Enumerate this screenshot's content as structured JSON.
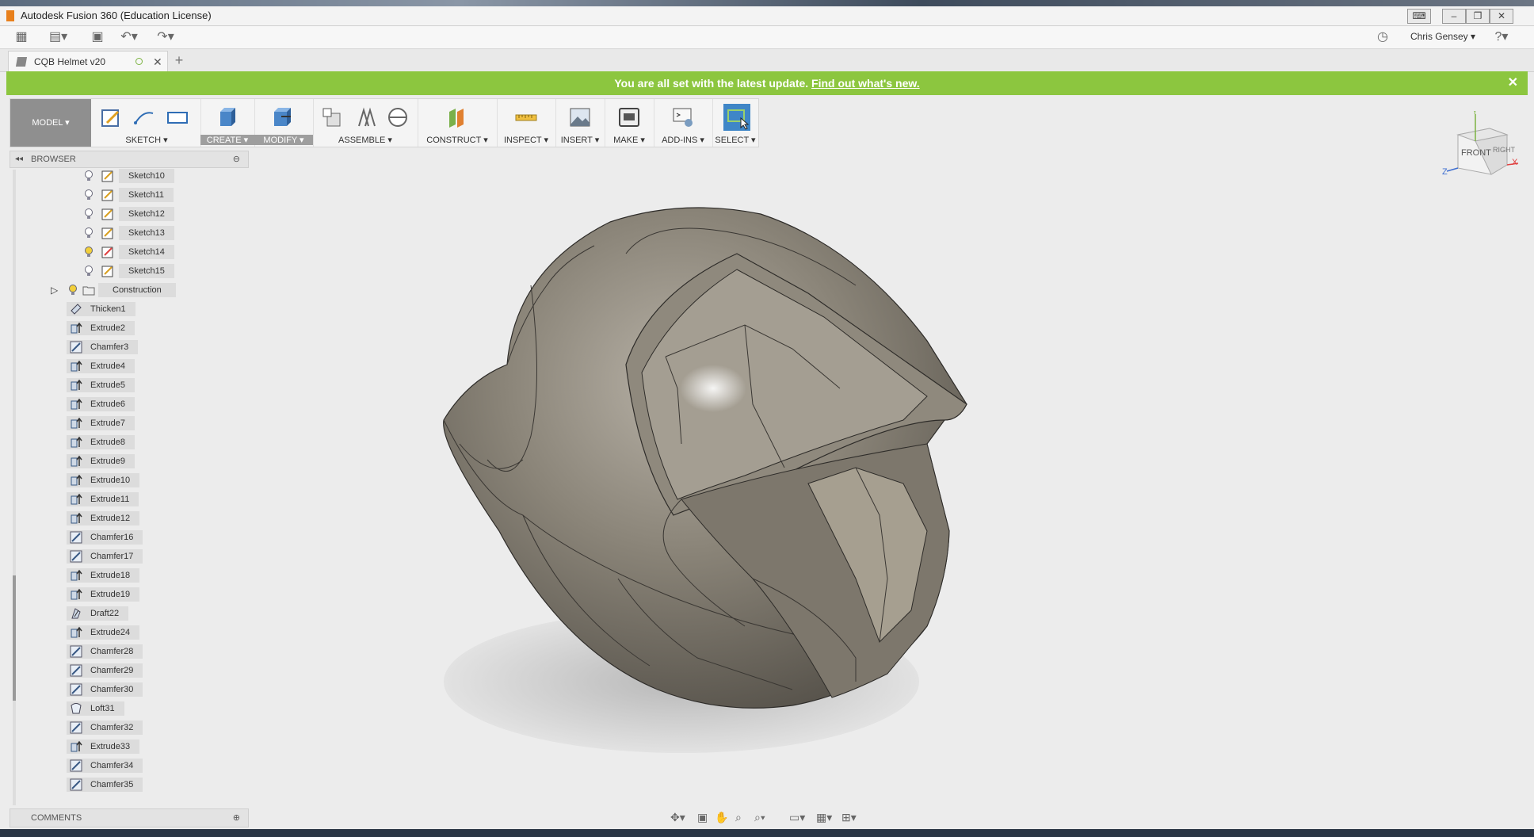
{
  "window": {
    "title": "Autodesk Fusion 360 (Education License)"
  },
  "toolbar": {
    "user": "Chris Gensey"
  },
  "tabs": {
    "document": "CQB Helmet v20",
    "new_tab": "+"
  },
  "notification": {
    "text": "You are all set with the latest update.",
    "link": "Find out what's new."
  },
  "ribbon": {
    "workspace": "MODEL",
    "groups": {
      "sketch": "SKETCH",
      "create": "CREATE",
      "modify": "MODIFY",
      "assemble": "ASSEMBLE",
      "construct": "CONSTRUCT",
      "inspect": "INSPECT",
      "insert": "INSERT",
      "make": "MAKE",
      "addins": "ADD-INS",
      "select": "SELECT"
    }
  },
  "browser": {
    "title": "BROWSER",
    "sketches": [
      "Sketch10",
      "Sketch11",
      "Sketch12",
      "Sketch13",
      "Sketch14",
      "Sketch15"
    ],
    "construction": "Construction",
    "features": [
      {
        "name": "Thicken1",
        "type": "thicken"
      },
      {
        "name": "Extrude2",
        "type": "extrude"
      },
      {
        "name": "Chamfer3",
        "type": "chamfer"
      },
      {
        "name": "Extrude4",
        "type": "extrude"
      },
      {
        "name": "Extrude5",
        "type": "extrude"
      },
      {
        "name": "Extrude6",
        "type": "extrude"
      },
      {
        "name": "Extrude7",
        "type": "extrude"
      },
      {
        "name": "Extrude8",
        "type": "extrude"
      },
      {
        "name": "Extrude9",
        "type": "extrude"
      },
      {
        "name": "Extrude10",
        "type": "extrude"
      },
      {
        "name": "Extrude11",
        "type": "extrude"
      },
      {
        "name": "Extrude12",
        "type": "extrude"
      },
      {
        "name": "Chamfer16",
        "type": "chamfer"
      },
      {
        "name": "Chamfer17",
        "type": "chamfer"
      },
      {
        "name": "Extrude18",
        "type": "extrude"
      },
      {
        "name": "Extrude19",
        "type": "extrude"
      },
      {
        "name": "Draft22",
        "type": "draft"
      },
      {
        "name": "Extrude24",
        "type": "extrude"
      },
      {
        "name": "Chamfer28",
        "type": "chamfer"
      },
      {
        "name": "Chamfer29",
        "type": "chamfer"
      },
      {
        "name": "Chamfer30",
        "type": "chamfer"
      },
      {
        "name": "Loft31",
        "type": "loft"
      },
      {
        "name": "Chamfer32",
        "type": "chamfer"
      },
      {
        "name": "Extrude33",
        "type": "extrude"
      },
      {
        "name": "Chamfer34",
        "type": "chamfer"
      },
      {
        "name": "Chamfer35",
        "type": "chamfer"
      }
    ]
  },
  "comments": {
    "title": "COMMENTS"
  },
  "viewcube": {
    "front": "FRONT",
    "right": "RIGHT",
    "axis_x": "X",
    "axis_y": "Y",
    "axis_z": "Z"
  },
  "colors": {
    "notify": "#8cc63f",
    "select_active": "#3f86c7",
    "model_body": "#8a8478"
  }
}
